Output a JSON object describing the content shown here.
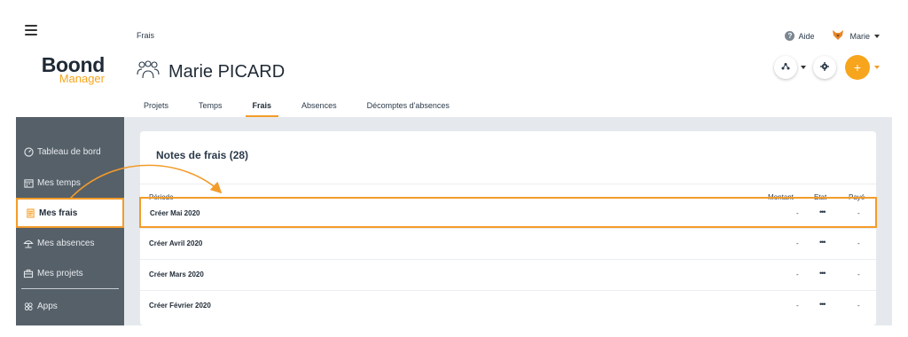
{
  "app": {
    "brand_line1": "Boond",
    "brand_line2": "Manager"
  },
  "sidebar": {
    "items": [
      {
        "label": "Tableau de bord",
        "icon": "dashboard-icon"
      },
      {
        "label": "Mes temps",
        "icon": "calendar-icon"
      },
      {
        "label": "Mes frais",
        "icon": "receipt-icon",
        "active": true
      },
      {
        "label": "Mes absences",
        "icon": "beach-umbrella-icon"
      },
      {
        "label": "Mes projets",
        "icon": "briefcase-icon"
      },
      {
        "label": "Apps",
        "icon": "apps-icon"
      }
    ]
  },
  "header": {
    "breadcrumb": "Frais",
    "title": "Marie PICARD",
    "help_label": "Aide",
    "user_name": "Marie",
    "tabs": [
      {
        "label": "Projets"
      },
      {
        "label": "Temps"
      },
      {
        "label": "Frais",
        "active": true
      },
      {
        "label": "Absences"
      },
      {
        "label": "Décomptes d'absences"
      }
    ],
    "add_symbol": "+"
  },
  "card": {
    "title": "Notes de frais (28)",
    "columns": {
      "period": "Période",
      "amount": "Montant",
      "state": "Etat",
      "paid": "Payé"
    },
    "rows": [
      {
        "label": "Créer Mai 2020",
        "amount": "-",
        "state": "•••",
        "paid": "-"
      },
      {
        "label": "Créer Avril 2020",
        "amount": "-",
        "state": "•••",
        "paid": "-"
      },
      {
        "label": "Créer Mars 2020",
        "amount": "-",
        "state": "•••",
        "paid": "-"
      },
      {
        "label": "Créer Février 2020",
        "amount": "-",
        "state": "•••",
        "paid": "-"
      }
    ]
  },
  "colors": {
    "accent": "#f39c2a",
    "sidebar": "#566069",
    "background": "#e5e9ed"
  }
}
